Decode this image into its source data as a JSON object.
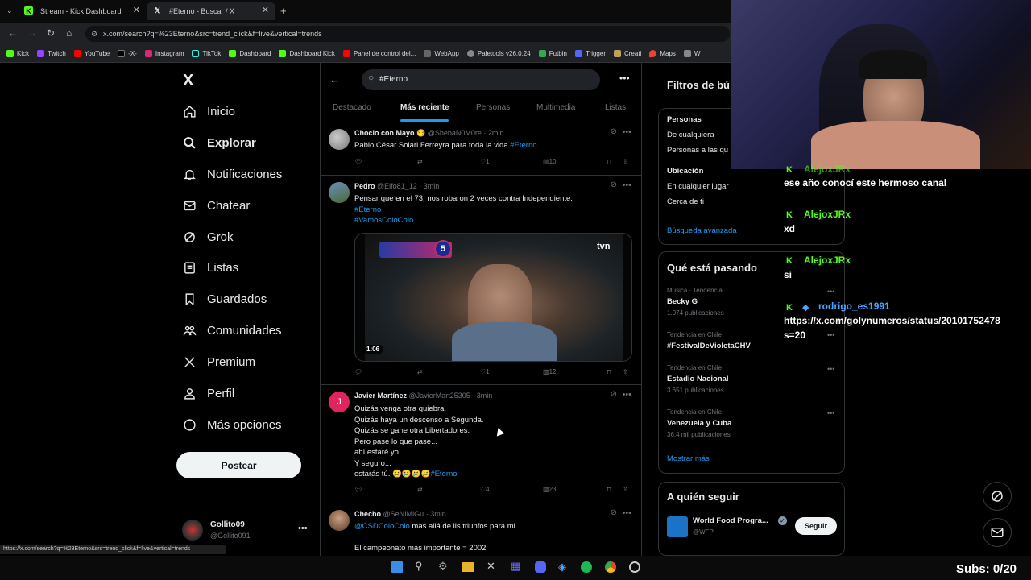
{
  "browser": {
    "tabs": [
      {
        "title": "Stream - Kick Dashboard"
      },
      {
        "title": "#Eterno - Buscar / X"
      }
    ],
    "new_tab": "+",
    "url": "x.com/search?q=%23Eterno&src=trend_click&f=live&vertical=trends",
    "bookmarks": [
      "Kick",
      "Twitch",
      "YouTube",
      "-X-",
      "Instagram",
      "TikTok",
      "Dashboard",
      "Dashboard Kick",
      "Panel de control del...",
      "WebApp",
      "Paletools v26.0.24",
      "Futbin",
      "Trigger",
      "Creati",
      "Maps",
      "W"
    ],
    "status_url": "https://x.com/search?q=%23Eterno&src=trend_click&f=live&vertical=trends"
  },
  "nav": {
    "logo": "X",
    "items": [
      {
        "label": "Inicio",
        "icon": "home-icon"
      },
      {
        "label": "Explorar",
        "icon": "search-icon"
      },
      {
        "label": "Notificaciones",
        "icon": "bell-icon"
      },
      {
        "label": "Chatear",
        "icon": "mail-icon"
      },
      {
        "label": "Grok",
        "icon": "grok-icon"
      },
      {
        "label": "Listas",
        "icon": "list-icon"
      },
      {
        "label": "Guardados",
        "icon": "bookmark-icon"
      },
      {
        "label": "Comunidades",
        "icon": "communities-icon"
      },
      {
        "label": "Premium",
        "icon": "x-icon"
      },
      {
        "label": "Perfil",
        "icon": "person-icon"
      },
      {
        "label": "Más opciones",
        "icon": "more-circle-icon"
      }
    ],
    "post_button": "Postear",
    "account": {
      "name": "Gollito09",
      "handle": "@Gollito091"
    }
  },
  "search": {
    "query": "#Eterno",
    "tabs": [
      "Destacado",
      "Más reciente",
      "Personas",
      "Multimedia",
      "Listas"
    ],
    "active_tab": "Más reciente"
  },
  "tweets": [
    {
      "name": "Choclo con Mayo 😏",
      "handle": "@ShebaN0M0re",
      "time": "2min",
      "lines": [
        "Pablo César Solari Ferreyra para toda la vida "
      ],
      "hashtag": "#Eterno",
      "replies": "",
      "retweets": "",
      "likes": "1",
      "views": "10"
    },
    {
      "name": "Pedro",
      "handle": "@Elfo81_12",
      "time": "3min",
      "lines": [
        "Pensar que en el 73, nos robaron 2 veces contra Independiente."
      ],
      "hashtags": [
        "#Eterno",
        "#VamosColoColo"
      ],
      "video_duration": "1:06",
      "video_channel": "tvn",
      "video_badge": "5",
      "likes": "1",
      "views": "12"
    },
    {
      "name": "Javier Martínez",
      "handle": "@JavierMart25305",
      "time": "3min",
      "lines": [
        "Quizás venga otra quiebra.",
        "Quizás haya un descenso a Segunda.",
        "Quizás se gane otra Libertadores.",
        "Pero pase lo que pase...",
        "ahí estaré yo.",
        "Y seguro...",
        "estarás tú. 🥲🥲🥲🥲"
      ],
      "hashtag": "#Eterno",
      "likes": "4",
      "views": "23"
    },
    {
      "name": "Checho",
      "handle": "@SeNIMiGu",
      "time": "3min",
      "mention": "@CSDColoColo",
      "line1": " mas allá de lls triunfos para mi...",
      "line2": "El campeonato mas importante = 2002"
    }
  ],
  "filters": {
    "title": "Filtros de bú",
    "people_heading": "Personas",
    "people_options": [
      "De cualquiera",
      "Personas a las qu"
    ],
    "location_heading": "Ubicación",
    "location_options": [
      "En cualquier lugar",
      "Cerca de ti"
    ],
    "advanced": "Búsqueda avanzada"
  },
  "trends": {
    "title": "Qué está pasando",
    "items": [
      {
        "context": "Música · Tendencia",
        "name": "Becky G",
        "count": "1.074 publicaciones"
      },
      {
        "context": "Tendencia en Chile",
        "name": "#FestivalDeVioletaCHV",
        "count": ""
      },
      {
        "context": "Tendencia en Chile",
        "name": "Estadio Nacional",
        "count": "3.651 publicaciones"
      },
      {
        "context": "Tendencia en Chile",
        "name": "Venezuela y Cuba",
        "count": "36,4 mil publicaciones"
      }
    ],
    "show_more": "Mostrar más"
  },
  "follow": {
    "title": "A quién seguir",
    "items": [
      {
        "name": "World Food Progra...",
        "handle": "@WFP",
        "button": "Seguir"
      }
    ]
  },
  "chat": [
    {
      "user": "AlejoxJRx",
      "text": "ese año conocí este hermoso canal"
    },
    {
      "user": "AlejoxJRx",
      "text": "xd"
    },
    {
      "user": "AlejoxJRx",
      "text": "si"
    },
    {
      "user": "rodrigo_es1991",
      "text": "https://x.com/golynumeros/status/20101752478",
      "text2": "s=20"
    }
  ],
  "overlay": {
    "subs": "Subs: 0/20"
  },
  "colors": {
    "accent": "#1d9bf0",
    "kick": "#53fc18"
  }
}
